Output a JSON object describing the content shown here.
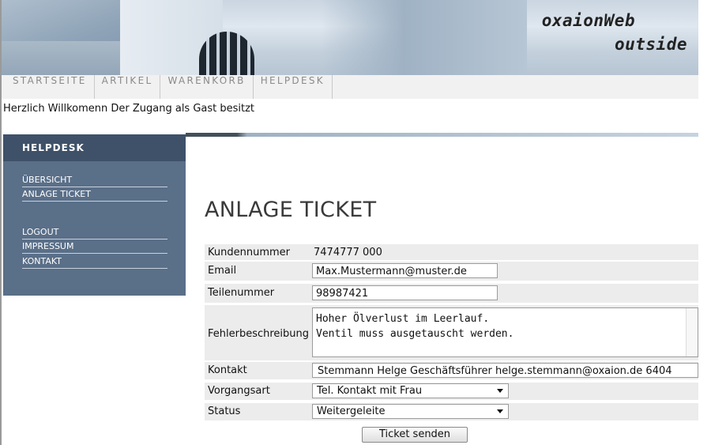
{
  "brand": {
    "line1": "oxaionWeb",
    "line2": "outside"
  },
  "nav": [
    {
      "label": "STARTSEITE"
    },
    {
      "label": "ARTIKEL"
    },
    {
      "label": "WARENKORB"
    },
    {
      "label": "HELPDESK"
    }
  ],
  "welcome": "Herzlich Willkomenn Der Zugang als Gast besitzt",
  "sidebar": {
    "title": "HELPDESK",
    "links": [
      {
        "label": "ÜBERSICHT"
      },
      {
        "label": "ANLAGE TICKET"
      },
      {
        "label": "LOGOUT"
      },
      {
        "label": "IMPRESSUM"
      },
      {
        "label": "KONTAKT"
      }
    ]
  },
  "form": {
    "title": "ANLAGE TICKET",
    "kundennummer": {
      "label": "Kundennummer",
      "value": "7474777 000"
    },
    "email": {
      "label": "Email",
      "value": "Max.Mustermann@muster.de"
    },
    "teilenummer": {
      "label": "Teilenummer",
      "value": "98987421"
    },
    "fehler": {
      "label": "Fehlerbeschreibung",
      "line1": "Hoher Ölverlust im Leerlauf.",
      "line2": "Ventil muss ausgetauscht werden."
    },
    "kontakt": {
      "label": "Kontakt",
      "value": "Stemmann Helge Geschäftsführer helge.stemmann@oxaion.de 6404"
    },
    "vorgangsart": {
      "label": "Vorgangsart",
      "value": "Tel. Kontakt mit Frau"
    },
    "status": {
      "label": "Status",
      "value": "Weitergeleite"
    },
    "submit": "Ticket senden"
  }
}
